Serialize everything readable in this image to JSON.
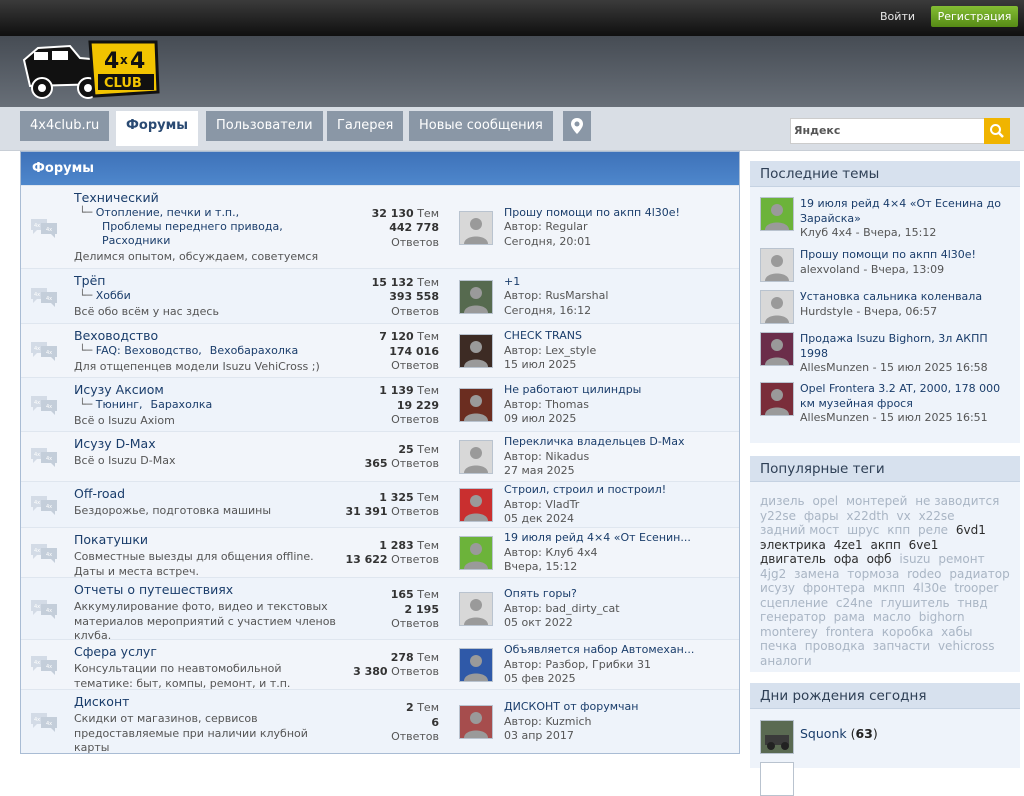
{
  "topbar": {
    "login": "Войти",
    "register": "Регистрация"
  },
  "nav": {
    "tabs": [
      "4x4club.ru",
      "Форумы",
      "Пользователи",
      "Галерея",
      "Новые сообщения"
    ],
    "search_placeholder": "Яндекс"
  },
  "forums_header": "Форумы",
  "forums": [
    {
      "title": "Технический",
      "sub_line1": [
        "Отопление, печки и т.п.,"
      ],
      "sub_line2": [
        "Проблемы переднего привода,"
      ],
      "sub_line3": [
        "Расходники"
      ],
      "desc": "Делимся опытом, обсуждаем, советуемся",
      "topics": "32 130",
      "posts": "442 778",
      "topics_label": "Тем",
      "posts_label": "Ответов",
      "last_title": "Прошу помощи по акпп 4l30e!",
      "last_author": "Автор: Regular",
      "last_date": "Сегодня, 20:01"
    },
    {
      "title": "Трёп",
      "sub_line1": [
        "Хобби"
      ],
      "desc": "Всё обо всём у нас здесь",
      "topics": "15 132",
      "posts": "393 558",
      "topics_label": "Тем",
      "posts_label": "Ответов",
      "last_title": "+1",
      "last_author": "Автор: RusMarshal",
      "last_date": "Сегодня, 16:12"
    },
    {
      "title": "Веховодство",
      "sub_line1": [
        "FAQ: Веховодство,",
        "Вехобарахолка"
      ],
      "desc": "Для отщепенцев модели Isuzu VehiCross ;)",
      "topics": "7 120",
      "posts": "174 016",
      "topics_label": "Тем",
      "posts_label": "Ответов",
      "last_title": "CHECK TRANS",
      "last_author": "Автор: Lex_style",
      "last_date": "15 июл 2025"
    },
    {
      "title": "Исузу Аксиом",
      "sub_line1": [
        "Тюнинг,",
        "Барахолка"
      ],
      "desc": "Всё о Isuzu Axiom",
      "topics": "1 139",
      "posts": "19 229",
      "topics_label": "Тем",
      "posts_label": "Ответов",
      "last_title": "Не работают цилиндры",
      "last_author": "Автор: Thomas",
      "last_date": "09 июл 2025"
    },
    {
      "title": "Исузу D-Max",
      "desc": "Всё о Isuzu D-Max",
      "topics": "25",
      "posts": "365",
      "topics_label": "Тем",
      "posts_label": "Ответов",
      "last_title": "Перекличка владельцев D-Max",
      "last_author": "Автор: Nikadus",
      "last_date": "27 мая 2025"
    },
    {
      "title": "Off-road",
      "desc": "Бездорожье, подготовка машины",
      "topics": "1 325",
      "posts": "31 391",
      "topics_label": "Тем",
      "posts_label": "Ответов",
      "last_title": "Строил, строил и построил!",
      "last_author": "Автор: VladTr",
      "last_date": "05 дек 2024"
    },
    {
      "title": "Покатушки",
      "desc": "Совместные выезды для общения offline.",
      "desc2": "Даты и места встреч.",
      "topics": "1 283",
      "posts": "13 622",
      "topics_label": "Тем",
      "posts_label": "Ответов",
      "last_title": "19 июля рейд 4×4 «От Есенин...",
      "last_author": "Автор: Клуб 4x4",
      "last_date": "Вчера, 15:12"
    },
    {
      "title": "Отчеты о путешествиях",
      "desc": "Аккумулирование фото, видео и текстовых",
      "desc2": "материалов мероприятий с участием членов",
      "desc3": "клуба.",
      "topics": "165",
      "posts": "2 195",
      "topics_label": "Тем",
      "posts_label": "Ответов",
      "last_title": "Опять горы?",
      "last_author": "Автор: bad_dirty_cat",
      "last_date": "05 окт 2022"
    },
    {
      "title": "Сфера услуг",
      "desc": "Консультации по неавтомобильной",
      "desc2": "тематике: быт, компы, ремонт, и т.п.",
      "topics": "278",
      "posts": "3 380",
      "topics_label": "Тем",
      "posts_label": "Ответов",
      "last_title": "Объявляется набор Автомехан...",
      "last_author": "Автор: Разбор, Грибки 31",
      "last_date": "05 фев 2025"
    },
    {
      "title": "Дисконт",
      "desc": "Скидки от магазинов, сервисов",
      "desc2": "предоставляемые при наличии клубной",
      "desc3": "карты",
      "topics": "2",
      "posts": "6",
      "topics_label": "Тем",
      "posts_label": "Ответов",
      "last_title": "ДИСКОНТ от форумчан",
      "last_author": "Автор: Kuzmich",
      "last_date": "03 апр 2017"
    }
  ],
  "sidebar": {
    "latest_title": "Последние темы",
    "latest": [
      {
        "title": "19 июля рейд 4×4 «От Есенина до Зарайска»",
        "meta": "Клуб 4x4 - Вчера, 15:12"
      },
      {
        "title": "Прошу помощи по акпп 4l30e!",
        "meta": "alexvoland - Вчера, 13:09"
      },
      {
        "title": "Установка сальника коленвала",
        "meta": "Hurdstyle - Вчера, 06:57"
      },
      {
        "title": "Продажа Isuzu Bighorn, 3л АКПП 1998",
        "meta": "AllesMunzen - 15 июл 2025 16:58"
      },
      {
        "title": "Opel Frontera 3.2 AT, 2000, 178 000 км музейная фрося",
        "meta": "AllesMunzen - 15 июл 2025 16:51"
      }
    ],
    "tags_title": "Популярные теги",
    "tags": [
      {
        "t": "дизель",
        "hi": false
      },
      {
        "t": "opel",
        "hi": false
      },
      {
        "t": "монтерей",
        "hi": false
      },
      {
        "t": "не заводится",
        "hi": false
      },
      {
        "t": "y22se",
        "hi": false
      },
      {
        "t": "фары",
        "hi": false
      },
      {
        "t": "x22dth",
        "hi": false
      },
      {
        "t": "vx",
        "hi": false
      },
      {
        "t": "x22se",
        "hi": false
      },
      {
        "t": "задний мост",
        "hi": false
      },
      {
        "t": "шрус",
        "hi": false
      },
      {
        "t": "кпп",
        "hi": false
      },
      {
        "t": "реле",
        "hi": false
      },
      {
        "t": "6vd1",
        "hi": true
      },
      {
        "t": "электрика",
        "hi": true
      },
      {
        "t": "4ze1",
        "hi": true
      },
      {
        "t": "акпп",
        "hi": true
      },
      {
        "t": "6ve1",
        "hi": true
      },
      {
        "t": "двигатель",
        "hi": true
      },
      {
        "t": "офа",
        "hi": true
      },
      {
        "t": "офб",
        "hi": true
      },
      {
        "t": "isuzu",
        "hi": false
      },
      {
        "t": "ремонт",
        "hi": false
      },
      {
        "t": "4jg2",
        "hi": false
      },
      {
        "t": "замена",
        "hi": false
      },
      {
        "t": "тормоза",
        "hi": false
      },
      {
        "t": "rodeo",
        "hi": false
      },
      {
        "t": "радиатор",
        "hi": false
      },
      {
        "t": "исузу",
        "hi": false
      },
      {
        "t": "фронтера",
        "hi": false
      },
      {
        "t": "мкпп",
        "hi": false
      },
      {
        "t": "4l30e",
        "hi": false
      },
      {
        "t": "trooper",
        "hi": false
      },
      {
        "t": "сцепление",
        "hi": false
      },
      {
        "t": "c24ne",
        "hi": false
      },
      {
        "t": "глушитель",
        "hi": false
      },
      {
        "t": "тнвд",
        "hi": false
      },
      {
        "t": "генератор",
        "hi": false
      },
      {
        "t": "рама",
        "hi": false
      },
      {
        "t": "масло",
        "hi": false
      },
      {
        "t": "bighorn",
        "hi": false
      },
      {
        "t": "monterey",
        "hi": false
      },
      {
        "t": "frontera",
        "hi": false
      },
      {
        "t": "коробка",
        "hi": false
      },
      {
        "t": "хабы",
        "hi": false
      },
      {
        "t": "печка",
        "hi": false
      },
      {
        "t": "проводка",
        "hi": false
      },
      {
        "t": "запчасти",
        "hi": false
      },
      {
        "t": "vehicross",
        "hi": false
      },
      {
        "t": "аналоги",
        "hi": false
      }
    ],
    "birthdays_title": "Дни рождения сегодня",
    "birthday_user": "Squonk",
    "birthday_age": "63"
  },
  "colors": {
    "accent": "#4a82c8",
    "register": "#6aa624",
    "link": "#1a3d6b"
  }
}
